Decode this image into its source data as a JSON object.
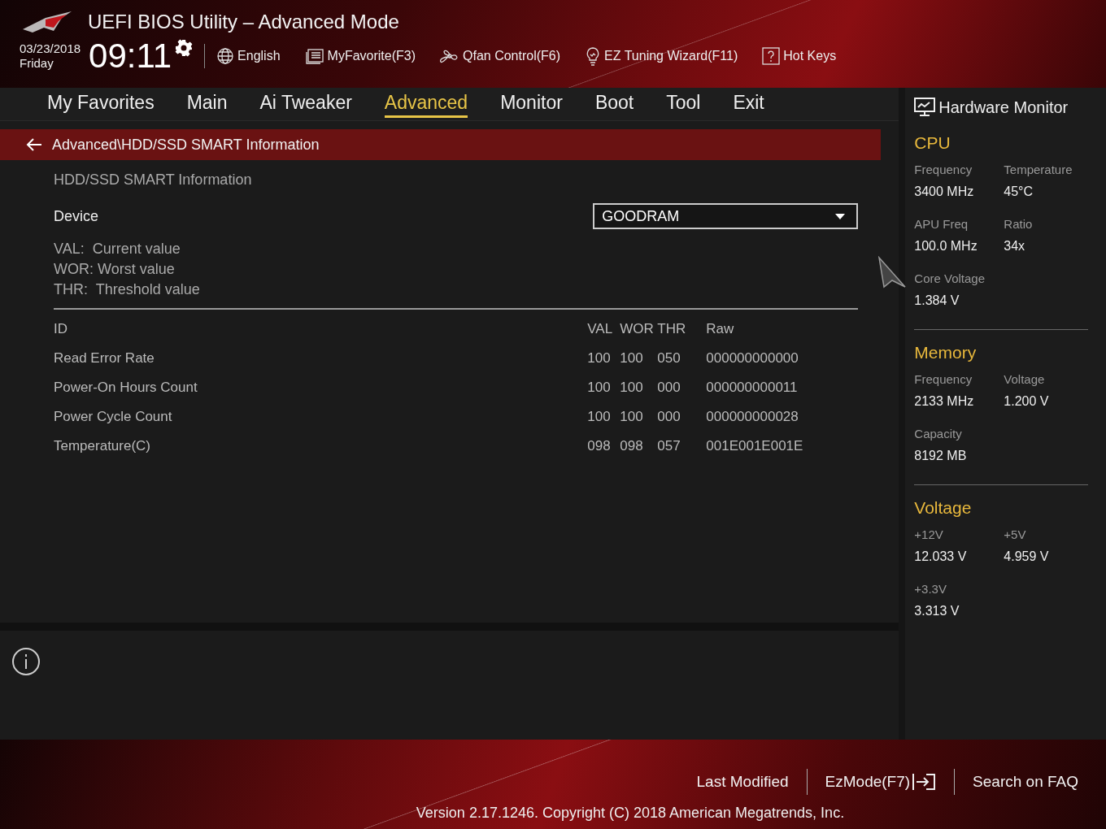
{
  "header": {
    "title": "UEFI BIOS Utility – Advanced Mode",
    "date": "03/23/2018",
    "day": "Friday",
    "time": "09:11",
    "tools": [
      {
        "kind": "globe",
        "label": "English"
      },
      {
        "kind": "favorite",
        "label": "MyFavorite(F3)"
      },
      {
        "kind": "fan",
        "label": "Qfan Control(F6)"
      },
      {
        "kind": "bulb",
        "label": "EZ Tuning Wizard(F11)"
      },
      {
        "kind": "help",
        "label": "Hot Keys"
      }
    ]
  },
  "tabs": [
    {
      "label": "My Favorites",
      "selected": false
    },
    {
      "label": "Main",
      "selected": false
    },
    {
      "label": "Ai Tweaker",
      "selected": false
    },
    {
      "label": "Advanced",
      "selected": true
    },
    {
      "label": "Monitor",
      "selected": false
    },
    {
      "label": "Boot",
      "selected": false
    },
    {
      "label": "Tool",
      "selected": false
    },
    {
      "label": "Exit",
      "selected": false
    }
  ],
  "breadcrumb": "Advanced\\HDD/SSD SMART Information",
  "section_title": "HDD/SSD SMART Information",
  "device": {
    "label": "Device",
    "value": "GOODRAM"
  },
  "legend": [
    "VAL:  Current value",
    "WOR: Worst value",
    "THR:  Threshold value"
  ],
  "smart_table": {
    "columns": [
      "ID",
      "VAL",
      "WOR",
      "THR",
      "Raw"
    ],
    "rows": [
      [
        "Read Error Rate",
        "100",
        "100",
        "050",
        "000000000000"
      ],
      [
        "Power-On Hours Count",
        "100",
        "100",
        "000",
        "000000000011"
      ],
      [
        "Power Cycle Count",
        "100",
        "100",
        "000",
        "000000000028"
      ],
      [
        "Temperature(C)",
        "098",
        "098",
        "057",
        "001E001E001E"
      ]
    ]
  },
  "hardware_monitor": {
    "title": "Hardware Monitor",
    "sections": [
      {
        "title": "CPU",
        "items": [
          {
            "label": "Frequency",
            "value": "3400 MHz"
          },
          {
            "label": "Temperature",
            "value": "45°C"
          },
          {
            "label": "APU Freq",
            "value": "100.0 MHz"
          },
          {
            "label": "Ratio",
            "value": "34x"
          },
          {
            "label": "Core Voltage",
            "value": "1.384 V"
          }
        ]
      },
      {
        "title": "Memory",
        "items": [
          {
            "label": "Frequency",
            "value": "2133 MHz"
          },
          {
            "label": "Voltage",
            "value": "1.200 V"
          },
          {
            "label": "Capacity",
            "value": "8192 MB"
          }
        ]
      },
      {
        "title": "Voltage",
        "items": [
          {
            "label": "+12V",
            "value": "12.033 V"
          },
          {
            "label": "+5V",
            "value": "4.959 V"
          },
          {
            "label": "+3.3V",
            "value": "3.313 V"
          }
        ]
      }
    ]
  },
  "footer": {
    "links": [
      {
        "kind": "text",
        "label": "Last Modified"
      },
      {
        "kind": "exit",
        "label": "EzMode(F7)"
      },
      {
        "kind": "text",
        "label": "Search on FAQ"
      }
    ],
    "version": "Version 2.17.1246. Copyright (C) 2018 American Megatrends, Inc."
  }
}
